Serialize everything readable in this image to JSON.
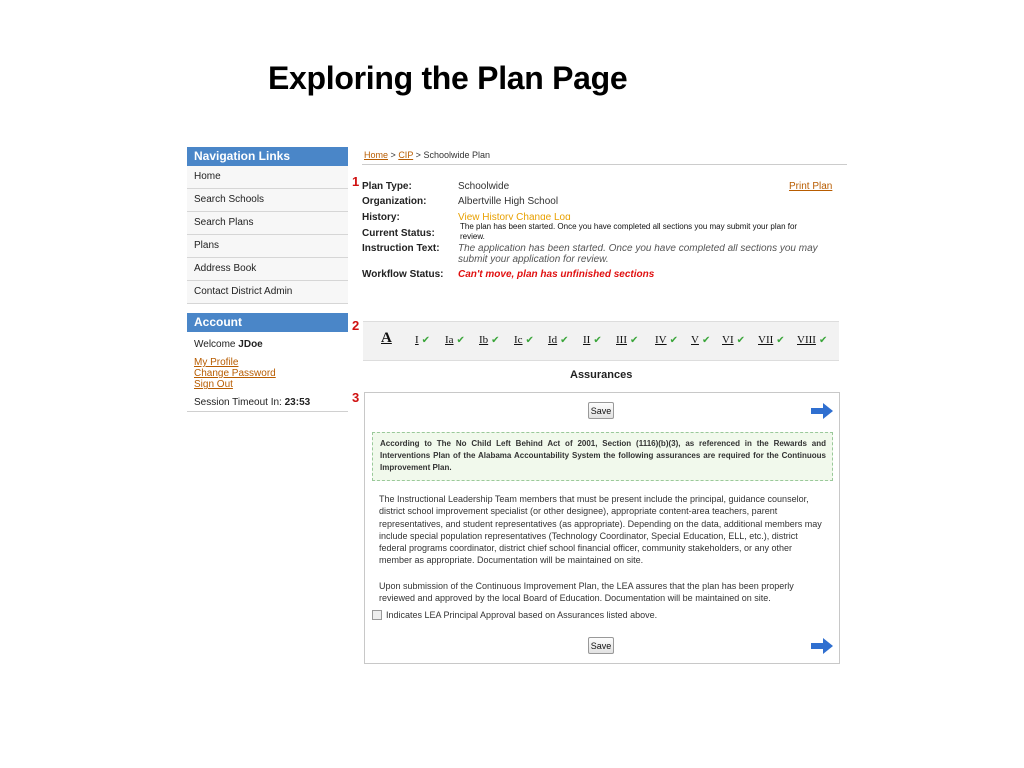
{
  "slide": {
    "title": "Exploring the Plan Page"
  },
  "nav": {
    "header": "Navigation Links",
    "items": [
      {
        "label": "Home"
      },
      {
        "label": "Search Schools"
      },
      {
        "label": "Search Plans"
      },
      {
        "label": "Plans"
      },
      {
        "label": "Address Book"
      },
      {
        "label": "Contact District Admin"
      }
    ]
  },
  "account": {
    "header": "Account",
    "welcome_prefix": "Welcome",
    "username": "JDoe",
    "links": [
      "My Profile",
      "Change Password",
      "Sign Out"
    ],
    "timeout_label": "Session Timeout In:",
    "timeout_value": "23:53"
  },
  "markers": [
    "1",
    "2",
    "3"
  ],
  "breadcrumb": {
    "home": "Home",
    "sep1": ">",
    "cip": "CIP",
    "sep2": ">",
    "current": "Schoolwide Plan"
  },
  "info": {
    "plan_type_label": "Plan Type:",
    "plan_type_value": "Schoolwide",
    "organization_label": "Organization:",
    "organization_value": "Albertville High School",
    "history_label": "History:",
    "history_value": "View History Change Log",
    "current_status_label": "Current Status:",
    "instruction_label": "Instruction Text:",
    "instruction_value": "The application has been started. Once you have completed all sections you may submit your application for review.",
    "workflow_label": "Workflow Status:",
    "workflow_value": "Can't move, plan has unfinished sections",
    "print_plan": "Print Plan",
    "tooltip": "The plan has been started. Once you have completed all sections you may submit your plan for review."
  },
  "tabs": {
    "first": "A",
    "items": [
      "I",
      "Ia",
      "Ib",
      "Ic",
      "Id",
      "II",
      "III",
      "IV",
      "V",
      "VI",
      "VII",
      "VIII"
    ],
    "check": "✔"
  },
  "assurances": {
    "title": "Assurances",
    "save_label": "Save",
    "notice": "According to The No Child Left Behind Act of 2001, Section (1116)(b)(3), as referenced in the Rewards and Interventions Plan of the Alabama Accountability System the following assurances are required for the Continuous Improvement Plan.",
    "para1": "The Instructional Leadership Team members that must be present include the principal, guidance counselor, district school improvement specialist (or other designee), appropriate content-area teachers, parent representatives, and student representatives (as appropriate). Depending on the data, additional members may include special population representatives (Technology Coordinator, Special Education, ELL, etc.), district federal programs coordinator, district chief school financial officer, community stakeholders, or any other member as appropriate. Documentation will be maintained on site.",
    "para2": "Upon submission of the Continuous Improvement Plan, the LEA assures that the plan has been properly reviewed and approved by the local Board of Education. Documentation will be maintained on site.",
    "approval_label": "Indicates LEA Principal Approval based on Assurances listed above."
  }
}
